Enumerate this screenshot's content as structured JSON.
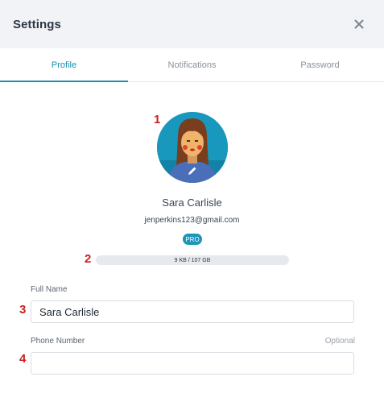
{
  "header": {
    "title": "Settings",
    "close_icon": "close-icon"
  },
  "tabs": [
    {
      "label": "Profile",
      "active": true
    },
    {
      "label": "Notifications",
      "active": false
    },
    {
      "label": "Password",
      "active": false
    }
  ],
  "markers": [
    "1",
    "2",
    "3",
    "4"
  ],
  "profile": {
    "avatar_icon": "avatar-woman",
    "edit_icon": "pencil-icon",
    "name": "Sara Carlisle",
    "email": "jenperkins123@gmail.com",
    "badge": "PRO",
    "storage_text": "9 KB / 107 GB"
  },
  "form": {
    "full_name_label": "Full Name",
    "full_name_value": "Sara Carlisle",
    "phone_label": "Phone Number",
    "phone_optional": "Optional",
    "phone_value": ""
  },
  "colors": {
    "accent": "#1b8fb0",
    "marker": "#cc1f1f",
    "header_bg": "#f1f3f6"
  }
}
